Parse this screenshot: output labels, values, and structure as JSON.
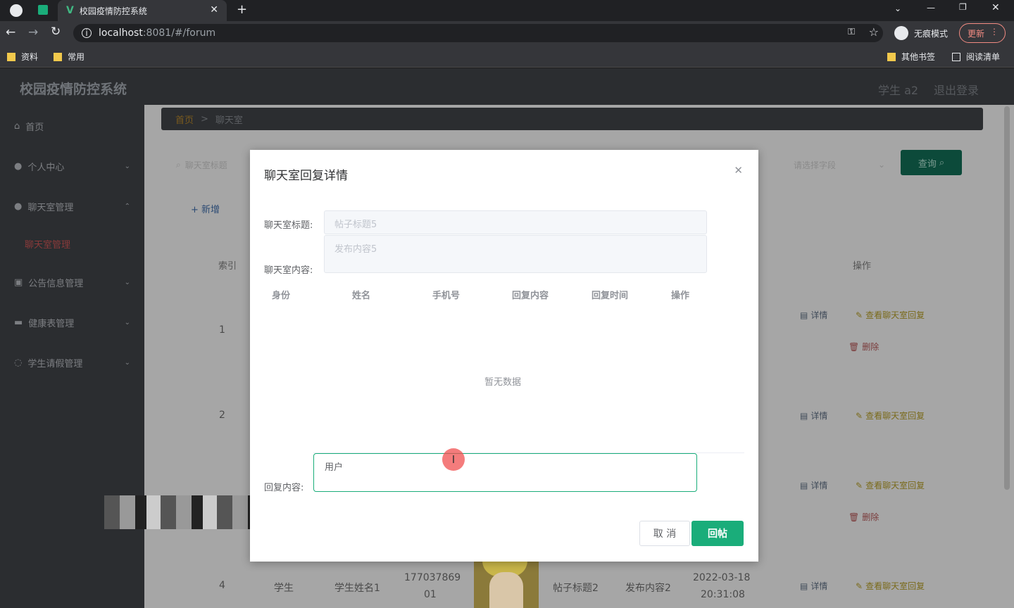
{
  "browser": {
    "tab_title": "校园疫情防控系统",
    "url_host": "localhost",
    "url_rest": ":8081/#/forum",
    "incognito_label": "无痕模式",
    "update_label": "更新",
    "bookmarks": [
      "资料",
      "常用"
    ],
    "other_bookmarks": "其他书签",
    "reading_list": "阅读清单"
  },
  "app": {
    "title": "校园疫情防控系统",
    "user": "学生 a2",
    "logout": "退出登录"
  },
  "breadcrumb": {
    "home": "首页",
    "sep": ">",
    "current": "聊天室"
  },
  "sidebar": {
    "items": [
      {
        "label": "首页"
      },
      {
        "label": "个人中心"
      },
      {
        "label": "聊天室管理"
      },
      {
        "label": "聊天室管理"
      },
      {
        "label": "公告信息管理"
      },
      {
        "label": "健康表管理"
      },
      {
        "label": "学生请假管理"
      }
    ]
  },
  "search": {
    "title_placeholder": "聊天室标题",
    "select_placeholder": "请选择字段",
    "query_label": "查询"
  },
  "toolbar": {
    "add_label": "+ 新增"
  },
  "table": {
    "index_header": "索引",
    "op_header": "操作",
    "rows": [
      {
        "index": "1"
      },
      {
        "index": "2"
      },
      {
        "index": "4",
        "identity": "学生",
        "name": "学生姓名1",
        "phone_a": "177037869",
        "phone_b": "01",
        "title": "帖子标题2",
        "content": "发布内容2",
        "date": "2022-03-18",
        "time": "20:31:08"
      }
    ],
    "detail_label": "详情",
    "reply_label": "查看聊天室回复",
    "delete_label": "删除"
  },
  "modal": {
    "title": "聊天室回复详情",
    "title_label": "聊天室标题:",
    "title_value": "帖子标题5",
    "content_label": "聊天室内容:",
    "content_value": "发布内容5",
    "columns": [
      "身份",
      "姓名",
      "手机号",
      "回复内容",
      "回复时间",
      "操作"
    ],
    "empty_text": "暂无数据",
    "reply_label": "回复内容:",
    "reply_value": "用户",
    "cancel_label": "取 消",
    "submit_label": "回帖"
  }
}
